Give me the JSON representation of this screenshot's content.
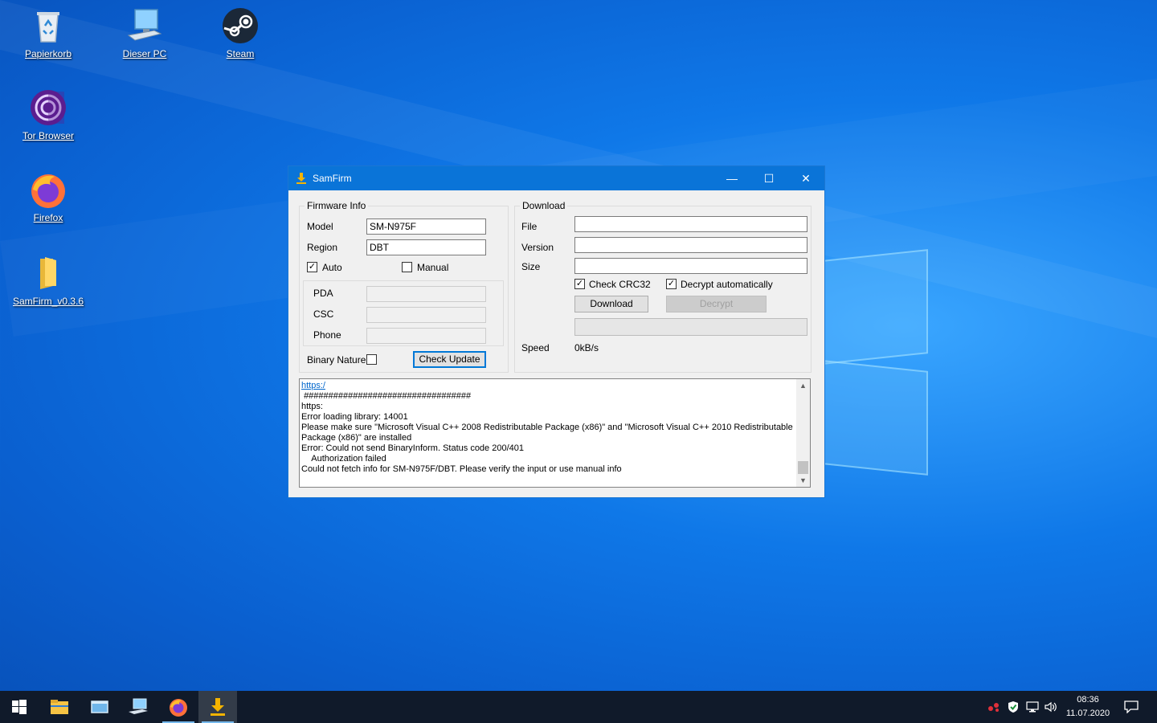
{
  "desktop": {
    "icons": [
      {
        "label": "Papierkorb"
      },
      {
        "label": "Dieser PC"
      },
      {
        "label": "Steam"
      },
      {
        "label": "Tor Browser"
      },
      {
        "label": "Firefox"
      },
      {
        "label": "SamFirm_v0.3.6"
      }
    ]
  },
  "window": {
    "title": "SamFirm",
    "controls": {
      "minimize": "—",
      "maximize": "☐",
      "close": "✕"
    },
    "firmware_info": {
      "legend": "Firmware Info",
      "model_label": "Model",
      "model_value": "SM-N975F",
      "region_label": "Region",
      "region_value": "DBT",
      "auto_label": "Auto",
      "auto_checked": "✓",
      "manual_label": "Manual",
      "pda_label": "PDA",
      "csc_label": "CSC",
      "phone_label": "Phone",
      "binary_nature_label": "Binary Nature",
      "check_update_label": "Check Update"
    },
    "download": {
      "legend": "Download",
      "file_label": "File",
      "version_label": "Version",
      "size_label": "Size",
      "check_crc32_label": "Check CRC32",
      "check_crc32_checked": "✓",
      "decrypt_auto_label": "Decrypt automatically",
      "decrypt_auto_checked": "✓",
      "download_button": "Download",
      "decrypt_button": "Decrypt",
      "speed_label": "Speed",
      "speed_value": "0kB/s"
    },
    "log": {
      "link": "https:/",
      "lines": [
        " ##################################",
        "https:",
        "Error loading library: 14001",
        "Please make sure \"Microsoft Visual C++ 2008 Redistributable Package (x86)\" and \"Microsoft Visual C++ 2010 Redistributable Package (x86)\" are installed",
        "Error: Could not send BinaryInform. Status code 200/401",
        "    Authorization failed",
        "Could not fetch info for SM-N975F/DBT. Please verify the input or use manual info"
      ]
    }
  },
  "taskbar": {
    "clock_time": "08:36",
    "clock_date": "11.07.2020",
    "items": [
      "start-icon",
      "file-explorer-icon",
      "window-icon",
      "computer-icon",
      "firefox-icon",
      "samfirm-icon"
    ]
  },
  "colors": {
    "accent": "#0a74d8",
    "desktop": "#0f78e8",
    "taskbar": "#101a2a"
  }
}
